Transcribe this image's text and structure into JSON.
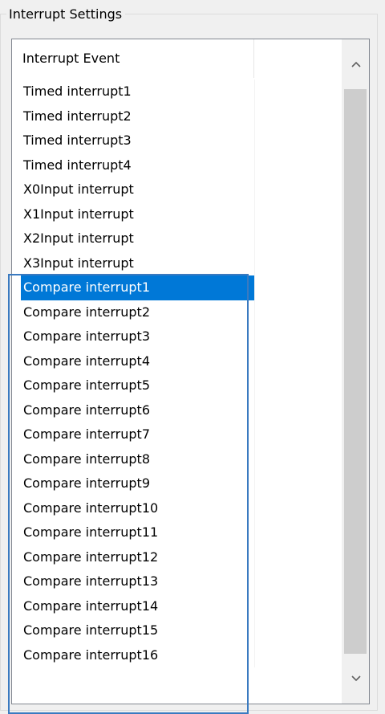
{
  "group": {
    "title": "Interrupt Settings"
  },
  "list": {
    "column_header": "Interrupt Event",
    "rows": [
      {
        "label": "Timed interrupt1",
        "selected": false
      },
      {
        "label": "Timed interrupt2",
        "selected": false
      },
      {
        "label": "Timed interrupt3",
        "selected": false
      },
      {
        "label": "Timed interrupt4",
        "selected": false
      },
      {
        "label": "X0Input interrupt",
        "selected": false
      },
      {
        "label": "X1Input interrupt",
        "selected": false
      },
      {
        "label": "X2Input interrupt",
        "selected": false
      },
      {
        "label": "X3Input interrupt",
        "selected": false
      },
      {
        "label": "Compare interrupt1",
        "selected": true
      },
      {
        "label": "Compare interrupt2",
        "selected": false
      },
      {
        "label": "Compare interrupt3",
        "selected": false
      },
      {
        "label": "Compare interrupt4",
        "selected": false
      },
      {
        "label": "Compare interrupt5",
        "selected": false
      },
      {
        "label": "Compare interrupt6",
        "selected": false
      },
      {
        "label": "Compare interrupt7",
        "selected": false
      },
      {
        "label": "Compare interrupt8",
        "selected": false
      },
      {
        "label": "Compare interrupt9",
        "selected": false
      },
      {
        "label": "Compare interrupt10",
        "selected": false
      },
      {
        "label": "Compare interrupt11",
        "selected": false
      },
      {
        "label": "Compare interrupt12",
        "selected": false
      },
      {
        "label": "Compare interrupt13",
        "selected": false
      },
      {
        "label": "Compare interrupt14",
        "selected": false
      },
      {
        "label": "Compare interrupt15",
        "selected": false
      },
      {
        "label": "Compare interrupt16",
        "selected": false
      }
    ]
  },
  "scrollbar": {
    "up_icon": "chevron-up-icon",
    "down_icon": "chevron-down-icon"
  },
  "colors": {
    "selection": "#0078d7",
    "highlight_box": "#3a7ac0"
  }
}
